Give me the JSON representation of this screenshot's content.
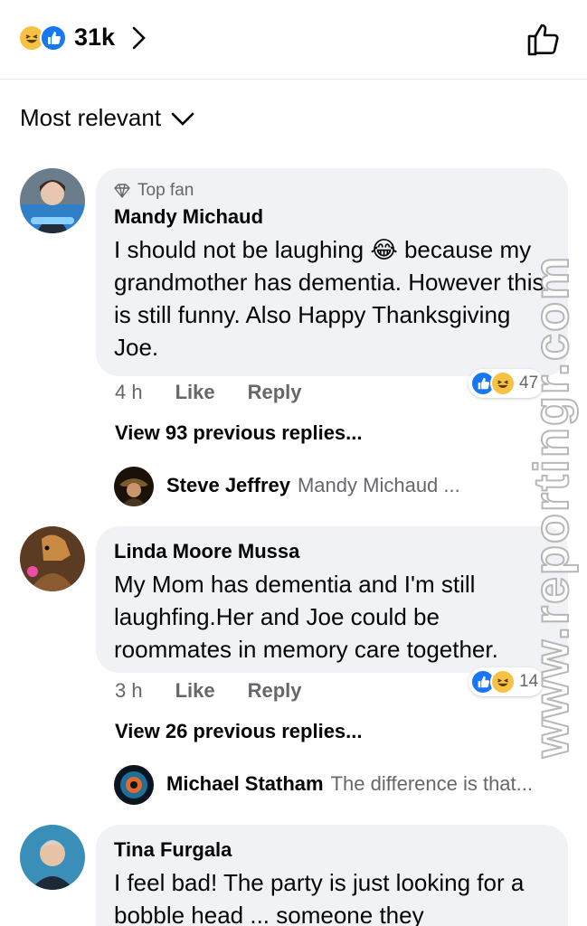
{
  "header": {
    "reaction_count": "31k",
    "reaction_icons": [
      "haha-icon",
      "like-icon"
    ],
    "like_icon": "thumbs-up-outline-icon"
  },
  "sort": {
    "label": "Most relevant"
  },
  "comments": [
    {
      "badge": "Top fan",
      "author": "Mandy Michaud",
      "text": "I should not be laughing 😂 because my grandmother has dementia. However this is still funny. Also Happy Thanksgiving Joe.",
      "time": "4 h",
      "like_label": "Like",
      "reply_label": "Reply",
      "reactions": "47",
      "view_replies": "View 93 previous replies...",
      "reply_preview": {
        "name": "Steve Jeffrey",
        "snippet": "Mandy Michaud ..."
      }
    },
    {
      "badge": "",
      "author": "Linda Moore Mussa",
      "text": "My Mom has dementia and I'm still laughfing.Her and Joe could be roommates in memory care together.",
      "time": "3 h",
      "like_label": "Like",
      "reply_label": "Reply",
      "reactions": "14",
      "view_replies": "View 26 previous replies...",
      "reply_preview": {
        "name": "Michael Statham",
        "snippet": "The difference is that..."
      }
    },
    {
      "badge": "",
      "author": "Tina Furgala",
      "text": "I feel bad! The party is just looking for a bobble head ... someone they"
    }
  ],
  "watermark": "www.reportingr.com",
  "colors": {
    "like_blue": "#1877f2",
    "haha_yellow": "#f7c244",
    "bubble": "#f0f2f5",
    "meta_gray": "#65676b"
  }
}
